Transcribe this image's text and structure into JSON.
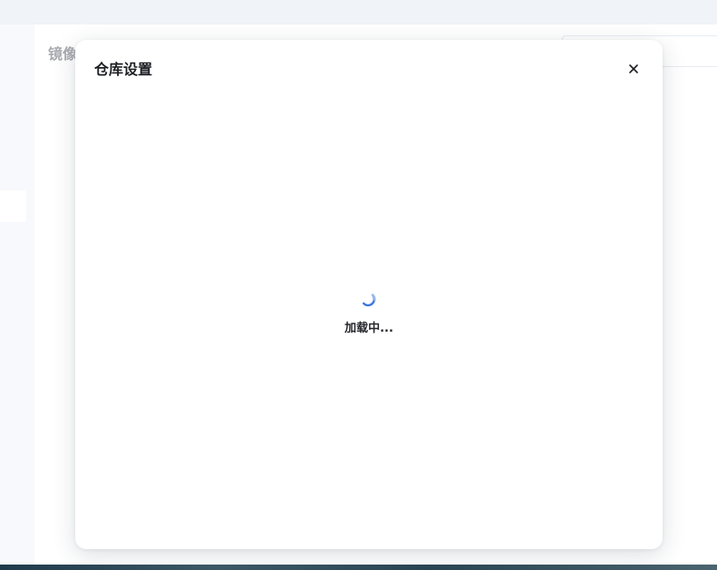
{
  "background": {
    "page_title": "镜像"
  },
  "modal": {
    "title": "仓库设置",
    "loading_text": "加载中..."
  },
  "colors": {
    "spinner_accent": "#3b76e1",
    "modal_bg": "#ffffff",
    "overlay_bg": "#f8f9fb"
  },
  "icons": {
    "close": "close-icon",
    "spinner": "loading-spinner-icon"
  }
}
